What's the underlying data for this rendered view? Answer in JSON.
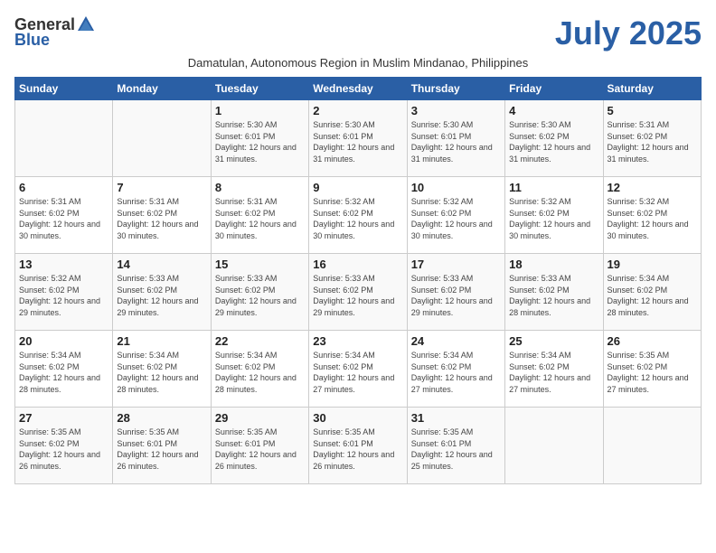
{
  "header": {
    "logo_general": "General",
    "logo_blue": "Blue",
    "month_title": "July 2025",
    "subtitle": "Damatulan, Autonomous Region in Muslim Mindanao, Philippines"
  },
  "days_of_week": [
    "Sunday",
    "Monday",
    "Tuesday",
    "Wednesday",
    "Thursday",
    "Friday",
    "Saturday"
  ],
  "weeks": [
    [
      {
        "day": "",
        "info": ""
      },
      {
        "day": "",
        "info": ""
      },
      {
        "day": "1",
        "info": "Sunrise: 5:30 AM\nSunset: 6:01 PM\nDaylight: 12 hours and 31 minutes."
      },
      {
        "day": "2",
        "info": "Sunrise: 5:30 AM\nSunset: 6:01 PM\nDaylight: 12 hours and 31 minutes."
      },
      {
        "day": "3",
        "info": "Sunrise: 5:30 AM\nSunset: 6:01 PM\nDaylight: 12 hours and 31 minutes."
      },
      {
        "day": "4",
        "info": "Sunrise: 5:30 AM\nSunset: 6:02 PM\nDaylight: 12 hours and 31 minutes."
      },
      {
        "day": "5",
        "info": "Sunrise: 5:31 AM\nSunset: 6:02 PM\nDaylight: 12 hours and 31 minutes."
      }
    ],
    [
      {
        "day": "6",
        "info": "Sunrise: 5:31 AM\nSunset: 6:02 PM\nDaylight: 12 hours and 30 minutes."
      },
      {
        "day": "7",
        "info": "Sunrise: 5:31 AM\nSunset: 6:02 PM\nDaylight: 12 hours and 30 minutes."
      },
      {
        "day": "8",
        "info": "Sunrise: 5:31 AM\nSunset: 6:02 PM\nDaylight: 12 hours and 30 minutes."
      },
      {
        "day": "9",
        "info": "Sunrise: 5:32 AM\nSunset: 6:02 PM\nDaylight: 12 hours and 30 minutes."
      },
      {
        "day": "10",
        "info": "Sunrise: 5:32 AM\nSunset: 6:02 PM\nDaylight: 12 hours and 30 minutes."
      },
      {
        "day": "11",
        "info": "Sunrise: 5:32 AM\nSunset: 6:02 PM\nDaylight: 12 hours and 30 minutes."
      },
      {
        "day": "12",
        "info": "Sunrise: 5:32 AM\nSunset: 6:02 PM\nDaylight: 12 hours and 30 minutes."
      }
    ],
    [
      {
        "day": "13",
        "info": "Sunrise: 5:32 AM\nSunset: 6:02 PM\nDaylight: 12 hours and 29 minutes."
      },
      {
        "day": "14",
        "info": "Sunrise: 5:33 AM\nSunset: 6:02 PM\nDaylight: 12 hours and 29 minutes."
      },
      {
        "day": "15",
        "info": "Sunrise: 5:33 AM\nSunset: 6:02 PM\nDaylight: 12 hours and 29 minutes."
      },
      {
        "day": "16",
        "info": "Sunrise: 5:33 AM\nSunset: 6:02 PM\nDaylight: 12 hours and 29 minutes."
      },
      {
        "day": "17",
        "info": "Sunrise: 5:33 AM\nSunset: 6:02 PM\nDaylight: 12 hours and 29 minutes."
      },
      {
        "day": "18",
        "info": "Sunrise: 5:33 AM\nSunset: 6:02 PM\nDaylight: 12 hours and 28 minutes."
      },
      {
        "day": "19",
        "info": "Sunrise: 5:34 AM\nSunset: 6:02 PM\nDaylight: 12 hours and 28 minutes."
      }
    ],
    [
      {
        "day": "20",
        "info": "Sunrise: 5:34 AM\nSunset: 6:02 PM\nDaylight: 12 hours and 28 minutes."
      },
      {
        "day": "21",
        "info": "Sunrise: 5:34 AM\nSunset: 6:02 PM\nDaylight: 12 hours and 28 minutes."
      },
      {
        "day": "22",
        "info": "Sunrise: 5:34 AM\nSunset: 6:02 PM\nDaylight: 12 hours and 28 minutes."
      },
      {
        "day": "23",
        "info": "Sunrise: 5:34 AM\nSunset: 6:02 PM\nDaylight: 12 hours and 27 minutes."
      },
      {
        "day": "24",
        "info": "Sunrise: 5:34 AM\nSunset: 6:02 PM\nDaylight: 12 hours and 27 minutes."
      },
      {
        "day": "25",
        "info": "Sunrise: 5:34 AM\nSunset: 6:02 PM\nDaylight: 12 hours and 27 minutes."
      },
      {
        "day": "26",
        "info": "Sunrise: 5:35 AM\nSunset: 6:02 PM\nDaylight: 12 hours and 27 minutes."
      }
    ],
    [
      {
        "day": "27",
        "info": "Sunrise: 5:35 AM\nSunset: 6:02 PM\nDaylight: 12 hours and 26 minutes."
      },
      {
        "day": "28",
        "info": "Sunrise: 5:35 AM\nSunset: 6:01 PM\nDaylight: 12 hours and 26 minutes."
      },
      {
        "day": "29",
        "info": "Sunrise: 5:35 AM\nSunset: 6:01 PM\nDaylight: 12 hours and 26 minutes."
      },
      {
        "day": "30",
        "info": "Sunrise: 5:35 AM\nSunset: 6:01 PM\nDaylight: 12 hours and 26 minutes."
      },
      {
        "day": "31",
        "info": "Sunrise: 5:35 AM\nSunset: 6:01 PM\nDaylight: 12 hours and 25 minutes."
      },
      {
        "day": "",
        "info": ""
      },
      {
        "day": "",
        "info": ""
      }
    ]
  ]
}
